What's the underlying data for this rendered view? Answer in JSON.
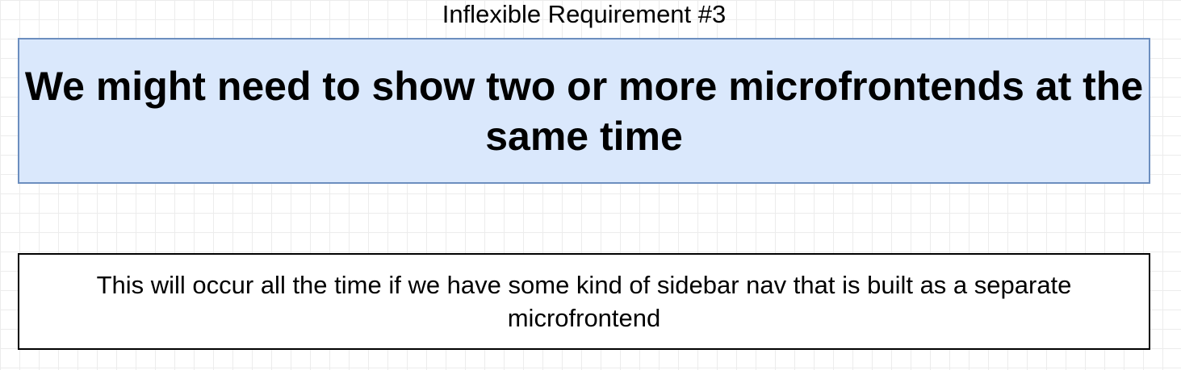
{
  "diagram": {
    "title": "Inflexible Requirement #3",
    "requirement_box": {
      "text": "We might need to show two or more microfrontends at the same time"
    },
    "note_box": {
      "text": "This will occur all the time if we have some kind of sidebar nav that is built as a separate microfrontend"
    },
    "colors": {
      "requirement_fill": "#dae8fc",
      "requirement_border": "#6c8ebf",
      "note_border": "#000000",
      "grid": "#ececec"
    }
  }
}
